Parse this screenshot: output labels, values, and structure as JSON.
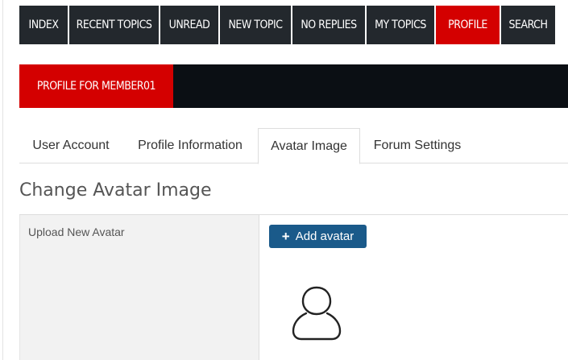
{
  "nav": {
    "items": [
      {
        "label": "INDEX",
        "active": false
      },
      {
        "label": "RECENT TOPICS",
        "active": false
      },
      {
        "label": "UNREAD",
        "active": false
      },
      {
        "label": "NEW TOPIC",
        "active": false
      },
      {
        "label": "NO REPLIES",
        "active": false
      },
      {
        "label": "MY TOPICS",
        "active": false
      },
      {
        "label": "PROFILE",
        "active": true
      },
      {
        "label": "SEARCH",
        "active": false
      }
    ]
  },
  "banner": {
    "title": "PROFILE FOR MEMBER01"
  },
  "tabs": [
    {
      "label": "User Account",
      "active": false
    },
    {
      "label": "Profile Information",
      "active": false
    },
    {
      "label": "Avatar Image",
      "active": true
    },
    {
      "label": "Forum Settings",
      "active": false
    }
  ],
  "section": {
    "heading": "Change Avatar Image",
    "upload_label": "Upload New Avatar",
    "add_button_label": "Add avatar",
    "avatar_icon": "user-silhouette-icon",
    "plus_icon": "plus-icon"
  },
  "colors": {
    "nav_bg": "#23282d",
    "accent_red": "#d40000",
    "banner_bg": "#0b0f14",
    "button_blue": "#1a5a8a"
  }
}
